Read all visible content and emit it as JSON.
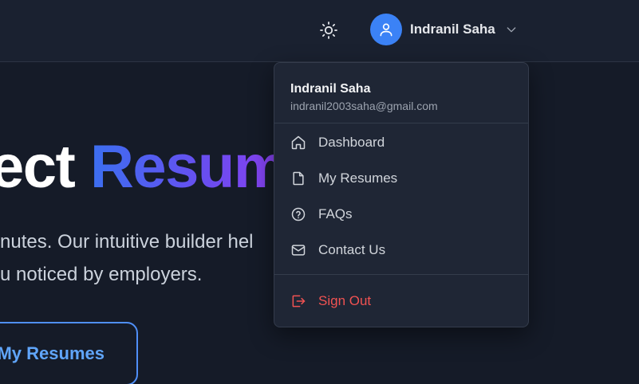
{
  "header": {
    "theme_toggle_icon": "sun-icon",
    "user": {
      "name": "Indranil Saha",
      "avatar_icon": "user-icon",
      "menu_icon": "chevron-down-icon"
    }
  },
  "hero": {
    "title_plain": "ect",
    "title_gradient": "Resum",
    "line1": "nutes. Our intuitive builder hel",
    "line2": "u noticed by employers.",
    "cta_label": "My Resumes"
  },
  "dropdown": {
    "name": "Indranil Saha",
    "email": "indranil2003saha@gmail.com",
    "items": [
      {
        "label": "Dashboard",
        "icon": "home-icon"
      },
      {
        "label": "My Resumes",
        "icon": "file-icon"
      },
      {
        "label": "FAQs",
        "icon": "help-circle-icon"
      },
      {
        "label": "Contact Us",
        "icon": "mail-icon"
      }
    ],
    "sign_out": {
      "label": "Sign Out",
      "icon": "sign-out-icon"
    }
  },
  "colors": {
    "background": "#151b28",
    "accent": "#3b82f6",
    "danger": "#f05252"
  }
}
